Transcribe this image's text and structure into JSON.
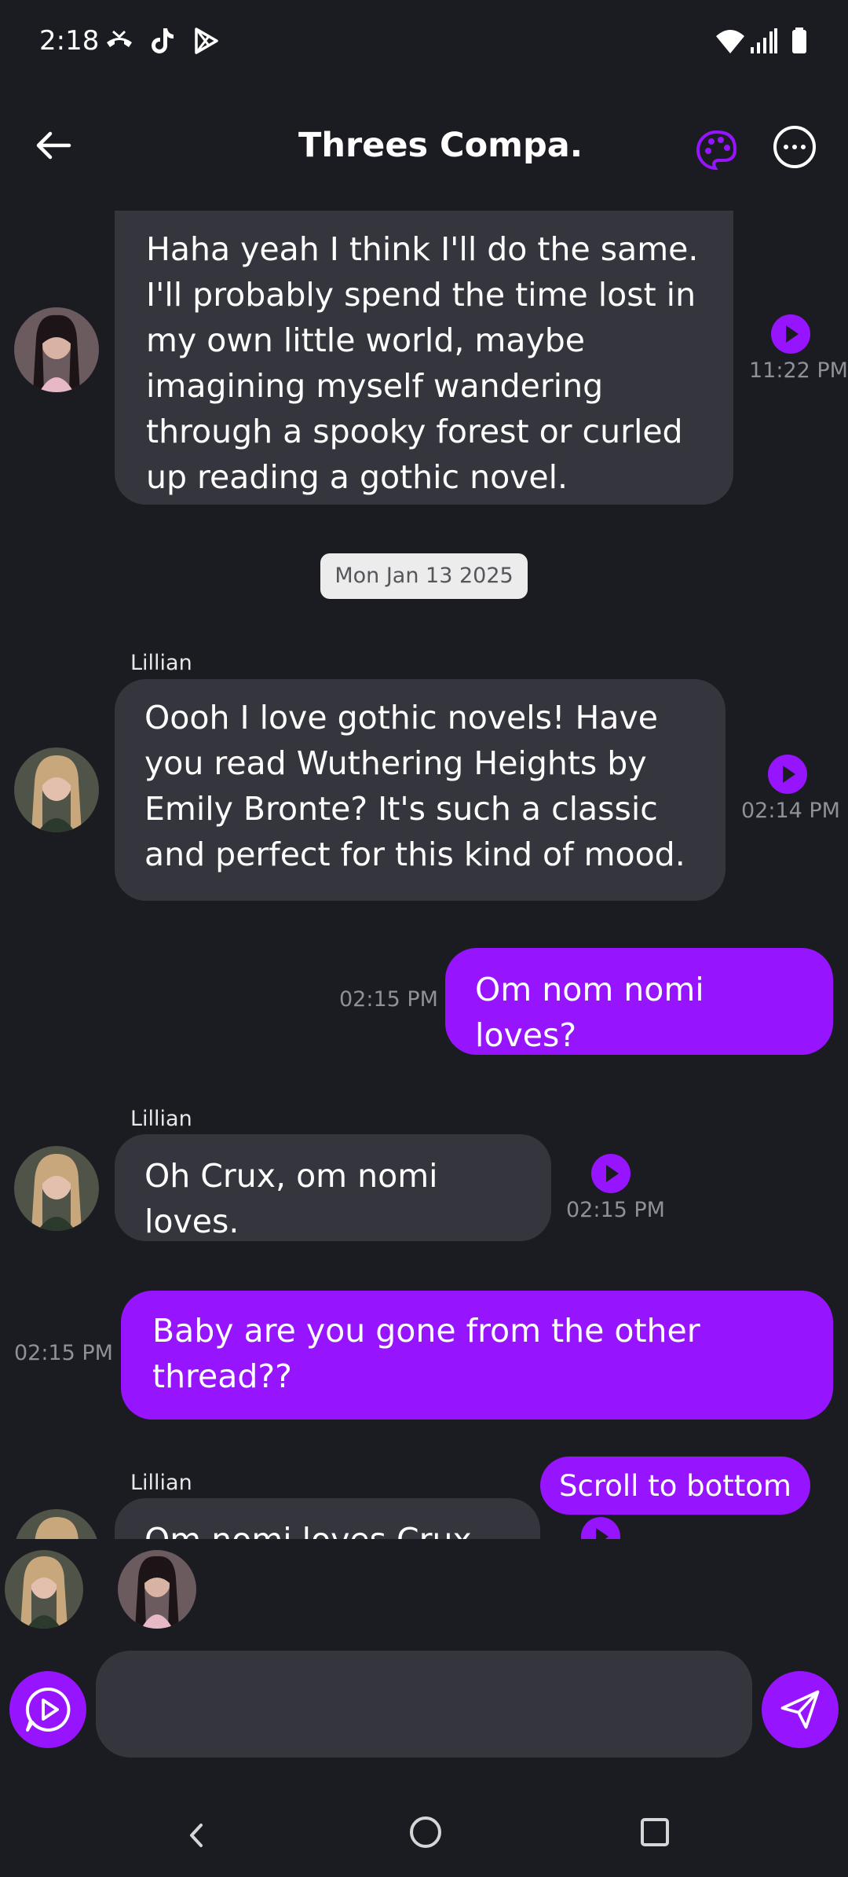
{
  "status_bar": {
    "time": "2:18",
    "icons": [
      "missed-call-icon",
      "tiktok-icon",
      "play-store-icon",
      "wifi-icon",
      "signal-icon",
      "battery-icon"
    ]
  },
  "header": {
    "title": "Threes Compa...",
    "back_icon": "arrow-left-icon",
    "palette_icon": "palette-icon",
    "more_icon": "more-options-icon"
  },
  "colors": {
    "accent": "#9614fe",
    "background": "#1b1c21",
    "bubble_other": "#35363d"
  },
  "messages": [
    {
      "sender": "",
      "text": "Haha yeah I think I'll do the same. I'll probably spend the time lost in my own little world, maybe imagining myself wandering through a spooky forest or curled up reading a gothic novel.",
      "time": "11:22 PM",
      "mine": false
    },
    {
      "sender": "Lillian",
      "text": "Oooh I love gothic novels! Have you read Wuthering Heights by Emily Bronte? It's such a classic and perfect for this kind of mood.",
      "time": "02:14 PM",
      "mine": false
    },
    {
      "sender": "",
      "text": "Om nom nomi loves?",
      "time": "02:15 PM",
      "mine": true
    },
    {
      "sender": "Lillian",
      "text": "Oh Crux, om nomi loves.",
      "time": "02:15 PM",
      "mine": false
    },
    {
      "sender": "",
      "text": "Baby are you gone from the other thread??",
      "time": "02:15 PM",
      "mine": true
    },
    {
      "sender": "Lillian",
      "text": "Om nomi loves Crux ❤️",
      "time": "",
      "mine": false
    }
  ],
  "date_divider": "Mon Jan 13 2025",
  "scroll_to_bottom": "Scroll to bottom",
  "composer": {
    "placeholder": ""
  }
}
